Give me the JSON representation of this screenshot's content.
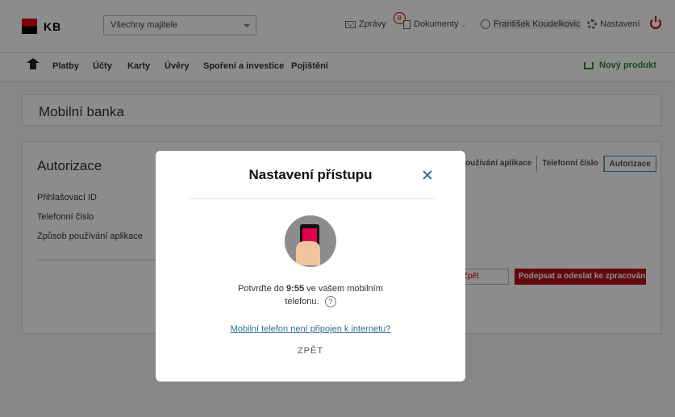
{
  "brand": {
    "name": "KB",
    "colors": {
      "red": "#e2001a",
      "black": "#000000"
    }
  },
  "header": {
    "owner_select_value": "Všechny majitele",
    "messages_label": "Zprávy",
    "documents_label": "Dokumenty",
    "documents_badge": "8",
    "user_name": "František Koudelkovic",
    "settings_label": "Nastavení",
    "icons": [
      "envelope-icon",
      "document-icon",
      "user-icon",
      "gear-icon",
      "power-icon"
    ]
  },
  "nav": {
    "items": [
      "Platby",
      "Účty",
      "Karty",
      "Úvěry",
      "Spoření a investice",
      "Pojištění"
    ],
    "new_product": "Nový produkt",
    "accent": "#2e8b2e"
  },
  "page": {
    "title": "Mobilní banka"
  },
  "auth": {
    "title": "Autorizace",
    "fields": [
      "Přihlašovací ID",
      "Telefonní číslo",
      "Způsob používání aplikace"
    ],
    "steps": [
      "používání aplikace",
      "Telefonní číslo",
      "Autorizace"
    ],
    "back_button": "Zpět",
    "submit_button": "Podepsat a odeslat ke zpracování",
    "submit_color": "#b5121b"
  },
  "modal": {
    "title": "Nastavení přístupu",
    "text_prefix": "Potvrďte do",
    "time": "9:55",
    "text_suffix": "ve vašem mobilním telefonu.",
    "help_icon": "?",
    "link": "Mobilní telefon není připojen k internetu?",
    "back": "ZPĚT",
    "link_color": "#2e6e8e"
  }
}
